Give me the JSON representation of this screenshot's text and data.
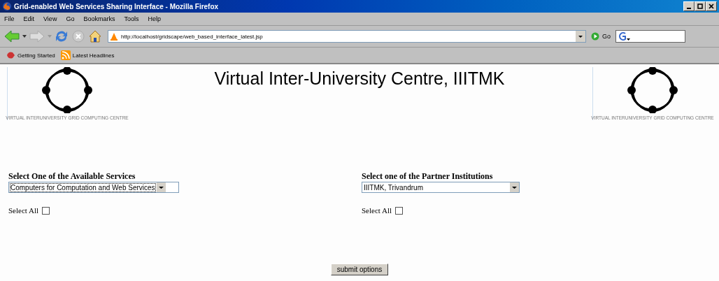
{
  "window": {
    "title": "Grid-enabled Web Services Sharing Interface - Mozilla Firefox"
  },
  "menu": [
    "File",
    "Edit",
    "View",
    "Go",
    "Bookmarks",
    "Tools",
    "Help"
  ],
  "toolbar": {
    "url": "http://localhost/gridscape/web_based_interface_latest.jsp",
    "go": "Go"
  },
  "bookmarks": [
    "Getting Started",
    "Latest Headlines"
  ],
  "page": {
    "heading": "Virtual Inter-University Centre, IIITMK",
    "logo_captions": [
      "VIRTUAL INTERUNIVERSITY GRID COMPUTING CENTRE",
      "VIRTUAL INTERUNIVERSITY GRID COMPUTING CENTRE"
    ],
    "sections": [
      {
        "label": "Select One of the Available Services",
        "value": "Computers for Computation and Web Services",
        "select_all": "Select All",
        "checked": false
      },
      {
        "label": "Select one of the Partner Institutions",
        "value": "IIITMK, Trivandrum",
        "select_all": "Select All",
        "checked": false
      }
    ],
    "submit": "submit options"
  }
}
